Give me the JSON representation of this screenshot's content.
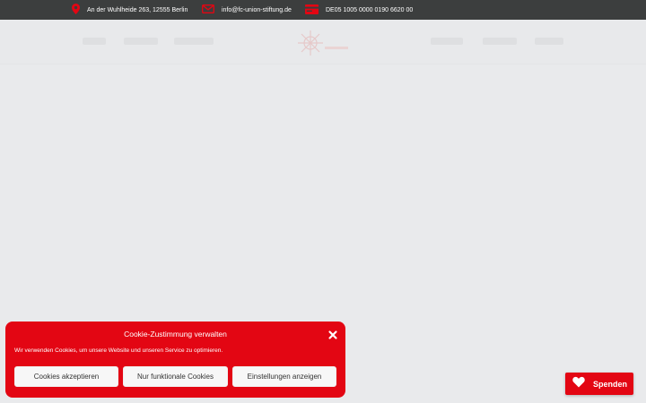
{
  "colors": {
    "accent": "#e30613",
    "topbar": "#3c3e3e",
    "background": "#e9eaec"
  },
  "topbar": {
    "address": {
      "icon": "map-pin-icon",
      "text": "An der Wuhlheide 263, 12555 Berlin"
    },
    "email": {
      "icon": "mail-icon",
      "text": "info@fc-union-stiftung.de"
    },
    "bank": {
      "icon": "credit-card-icon",
      "text": "DE05 1005 0000 0190 6620 00"
    }
  },
  "cookie_banner": {
    "title": "Cookie-Zustimmung verwalten",
    "text": "Wir verwenden Cookies, um unsere Website und unseren Service zu optimieren.",
    "accept_label": "Cookies akzeptieren",
    "functional_label": "Nur funktionale Cookies",
    "settings_label": "Einstellungen anzeigen",
    "close_icon": "close-icon"
  },
  "donate_button": {
    "label": "Spenden",
    "icon": "heart-icon"
  }
}
